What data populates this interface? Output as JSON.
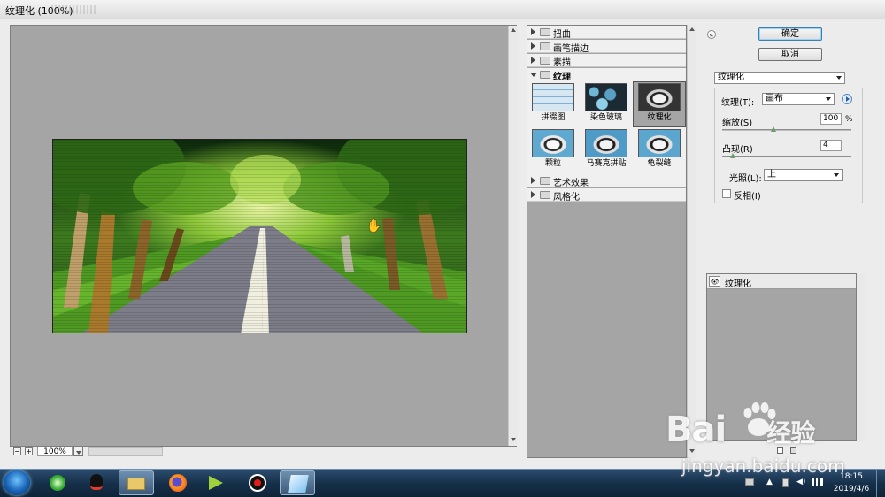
{
  "window": {
    "title": "纹理化 (100%)"
  },
  "preview": {
    "zoom": "100%",
    "zoom_out": "−",
    "zoom_in": "+"
  },
  "filter_gallery": {
    "categories_top": [
      "扭曲",
      "画笔描边",
      "素描"
    ],
    "open_category": "纹理",
    "thumbnails": [
      "拼缀图",
      "染色玻璃",
      "纹理化",
      "颗粒",
      "马赛克拼贴",
      "龟裂缝"
    ],
    "selected_thumbnail": "纹理化",
    "categories_bottom": [
      "艺术效果",
      "风格化"
    ]
  },
  "buttons": {
    "ok": "确定",
    "cancel": "取消",
    "collapse": "«"
  },
  "settings": {
    "filter_select": "纹理化",
    "texture_label": "纹理(T):",
    "texture_value": "画布",
    "scaling_label": "缩放(S)",
    "scaling_value": "100",
    "scaling_unit": "%",
    "scaling_fraction": 0.4,
    "relief_label": "凸现(R)",
    "relief_value": "4",
    "relief_fraction": 0.08,
    "light_label": "光照(L):",
    "light_value": "上",
    "invert_label": "反相(I)",
    "invert_checked": false
  },
  "layers": {
    "effect_layer": "纹理化"
  },
  "taskbar": {
    "apps": [
      "start",
      "browser-360",
      "qq",
      "file-explorer",
      "firefox",
      "video-player",
      "screen-recorder",
      "photoshop"
    ],
    "time": "18:15",
    "date": "2019/4/6"
  },
  "watermark": {
    "logo": "Bai",
    "logo_tail": "经验",
    "url": "jingyan.baidu.com"
  },
  "colors": {
    "accent": "#3c7fb1",
    "panel_gray": "#a5a5a5",
    "taskbar": "#16304a"
  }
}
